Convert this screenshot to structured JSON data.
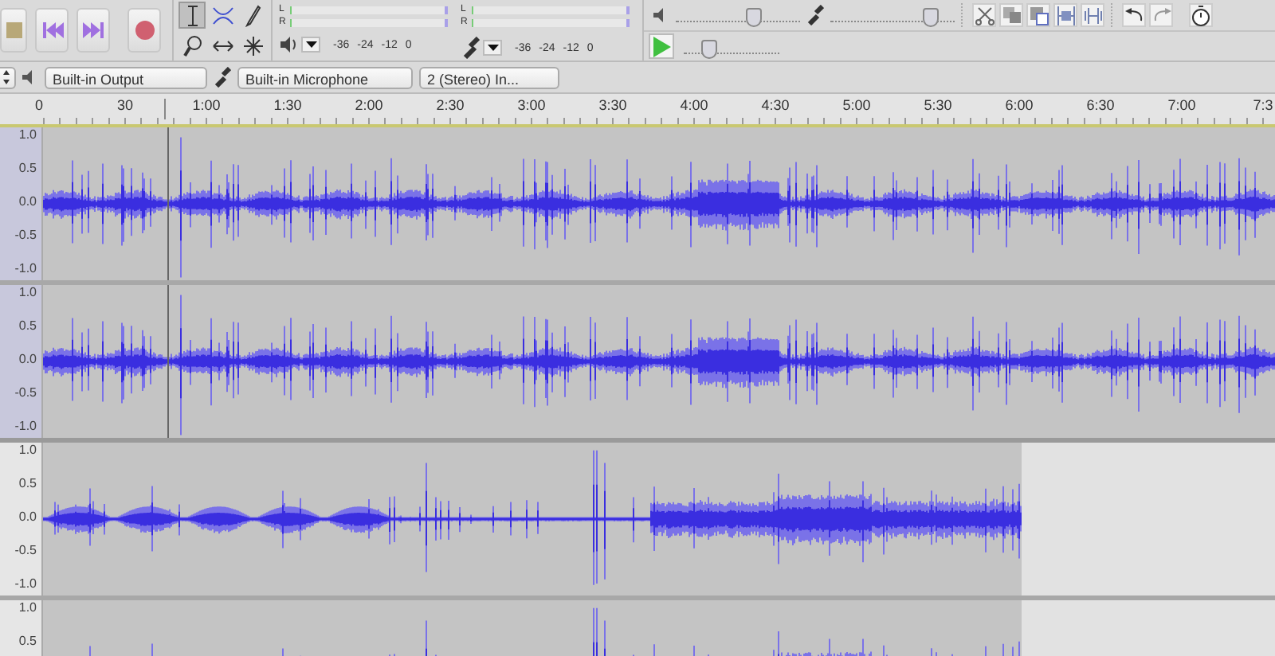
{
  "transport": [
    {
      "kind": "stop"
    },
    {
      "kind": "skip_start"
    },
    {
      "kind": "skip_end"
    },
    {
      "kind": "record"
    }
  ],
  "tools": [
    {
      "kind": "select",
      "selected": true
    },
    {
      "kind": "envelope",
      "selected": false
    },
    {
      "kind": "draw",
      "selected": false
    },
    {
      "kind": "zoom",
      "selected": false
    },
    {
      "kind": "timeshift",
      "selected": false
    },
    {
      "kind": "multi",
      "selected": false
    }
  ],
  "meters": [
    {
      "kind": "playback",
      "channels": [
        "L",
        "R"
      ],
      "scale": [
        "-36",
        "-24",
        "-12",
        "0"
      ]
    },
    {
      "kind": "record",
      "channels": [
        "L",
        "R"
      ],
      "scale": [
        "-36",
        "-24",
        "-12",
        "0"
      ]
    }
  ],
  "mixer": [
    {
      "kind": "output",
      "level": 0.62
    },
    {
      "kind": "input",
      "level": 0.8
    }
  ],
  "play_at_speed": {
    "level": 0.25
  },
  "device_bar": {
    "output": "Built-in Output",
    "input": "Built-in Microphone",
    "channels": "2 (Stereo) In..."
  },
  "ruler": {
    "labels": [
      "0",
      "30",
      "1:00",
      "1:30",
      "2:00",
      "2:30",
      "3:00",
      "3:30",
      "4:00",
      "4:30",
      "5:00",
      "5:30",
      "6:00",
      "6:30",
      "7:00",
      "7:3"
    ]
  },
  "tracks": [
    {
      "selected": true,
      "kind": "full",
      "axis": [
        "1.0",
        "0.5",
        "0.0",
        "-0.5",
        "-1.0"
      ]
    },
    {
      "selected": true,
      "kind": "full",
      "axis": [
        "1.0",
        "0.5",
        "0.0",
        "-0.5",
        "-1.0"
      ]
    },
    {
      "selected": false,
      "kind": "clip",
      "axis": [
        "1.0",
        "0.5",
        "0.0",
        "-0.5",
        "-1.0"
      ]
    },
    {
      "selected": false,
      "kind": "clip",
      "axis": [
        "1.0",
        "0.5"
      ]
    }
  ]
}
